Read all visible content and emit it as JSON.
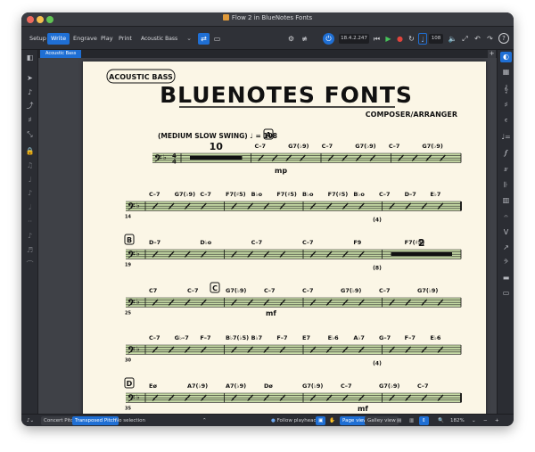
{
  "window": {
    "title": "Flow 2 in BlueNotes Fonts"
  },
  "toolbar": {
    "modes": [
      {
        "label": "Setup",
        "active": false
      },
      {
        "label": "Write",
        "active": true
      },
      {
        "label": "Engrave",
        "active": false
      },
      {
        "label": "Play",
        "active": false
      },
      {
        "label": "Print",
        "active": false
      }
    ],
    "instrument": "Acoustic Bass",
    "time_display": "18.4.2.247",
    "tempo": "108"
  },
  "tabstrip": {
    "layout_tab": "Acoustic Bass",
    "add_symbol": "+"
  },
  "score": {
    "part_name": "ACOUSTIC BASS",
    "title": "BLUENOTES FONTS",
    "composer": "COMPOSER/ARRANGER",
    "tempo_text": "(MEDIUM SLOW SWING) ♩ = 108",
    "time_signature_top": "4",
    "time_signature_bottom": "4",
    "dynamic": "mp",
    "dynamic_mf": "mf",
    "systems": [
      {
        "rehearsal": "A",
        "measure_number": "",
        "multirest": "10",
        "chords": [
          "C–7",
          "G7(♭9)",
          "C–7",
          "G7(♭9)",
          "C–7",
          "G7(♭9)"
        ]
      },
      {
        "rehearsal": "",
        "measure_number": "14",
        "chords": [
          "C–7",
          "G7(♭9)",
          "C–7",
          "F7(♯5)",
          "B♭o",
          "F7(♯5)",
          "B♭o",
          "F7(♯5)",
          "B♭o",
          "C–7",
          "D–7",
          "E♭7"
        ],
        "annotation": "(4)"
      },
      {
        "rehearsal": "B",
        "measure_number": "19",
        "multirest": "2",
        "chords": [
          "D–7",
          "D♭o",
          "C–7",
          "C–7",
          "F9",
          "F7(♯5)"
        ],
        "annotation": "(8)"
      },
      {
        "rehearsal": "C",
        "measure_number": "25",
        "chords": [
          "C7",
          "C–7",
          "G7(♭9)",
          "C–7",
          "C–7",
          "G7(♭9)",
          "C–7",
          "G7(♭9)"
        ]
      },
      {
        "rehearsal": "",
        "measure_number": "30",
        "chords": [
          "C–7",
          "G♭–7",
          "F–7",
          "B♭7(♭5)",
          "B♭7",
          "F–7",
          "E7",
          "E♭6",
          "A♭7",
          "G–7",
          "F–7",
          "E♭6"
        ],
        "annotation": "(4)"
      },
      {
        "rehearsal": "D",
        "measure_number": "35",
        "chords": [
          "Eø",
          "A7(♭9)",
          "A7(♭9)",
          "Dø",
          "G7(♭9)",
          "C–7",
          "G7(♭9)",
          "C–7"
        ]
      }
    ]
  },
  "statusbar": {
    "concert_pitch": "Concert Pitch",
    "transposed_pitch": "Transposed Pitch",
    "selection": "No selection",
    "follow_playhead": "Follow playhead",
    "page_view": "Page view",
    "galley_view": "Galley view",
    "zoom": "182%"
  },
  "colors": {
    "accent": "#1f6fd4",
    "staff_highlight": "#c5d9a5",
    "paper": "#fbf6e6"
  }
}
